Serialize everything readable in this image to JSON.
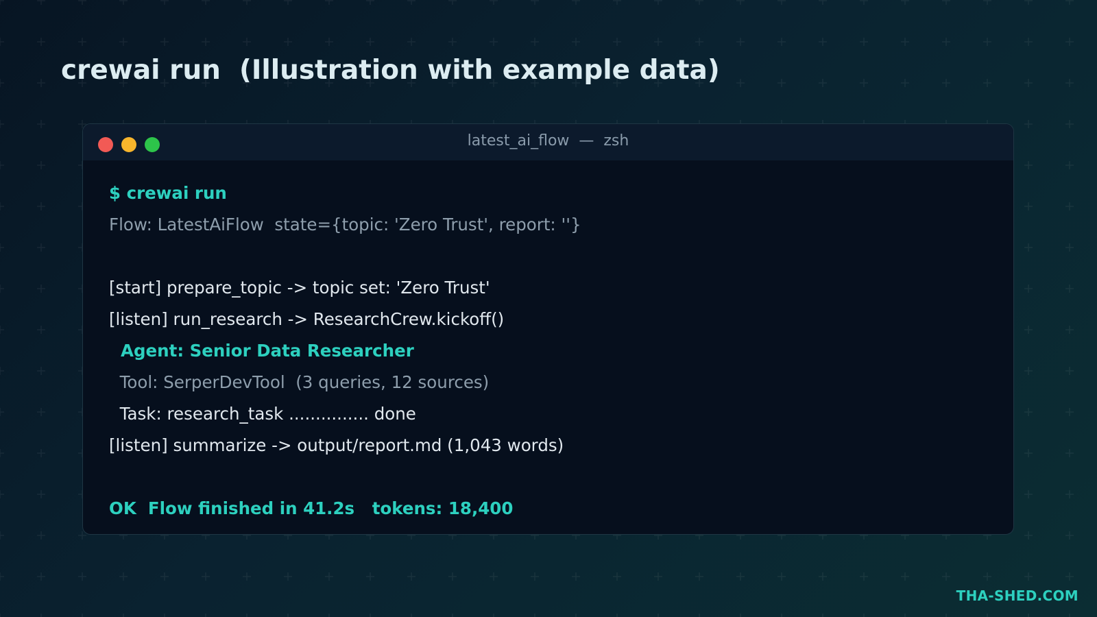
{
  "page": {
    "title": "crewai run  (Illustration with example data)",
    "watermark": "THA-SHED.COM"
  },
  "terminal": {
    "window_title": "latest_ai_flow  —  zsh",
    "controls": [
      "close",
      "minimize",
      "zoom"
    ],
    "lines": {
      "command": "$ crewai run",
      "flow_info": "Flow: LatestAiFlow  state={topic: 'Zero Trust', report: ''}",
      "start_step": "[start] prepare_topic -> topic set: 'Zero Trust'",
      "listen_research": "[listen] run_research -> ResearchCrew.kickoff()",
      "agent": "  Agent: Senior Data Researcher",
      "tool": "  Tool: SerperDevTool  (3 queries, 12 sources)",
      "task": "  Task: research_task ............... done",
      "listen_summarize": "[listen] summarize -> output/report.md (1,043 words)",
      "result": "OK  Flow finished in 41.2s   tokens: 18,400"
    }
  },
  "colors": {
    "accent": "#2dd0bf",
    "title_text": "#dcecf1",
    "terminal_bg": "#060f1d",
    "titlebar_bg": "#0c1a2c",
    "dim_text": "#8e9eac",
    "close_button": "#f25a55",
    "minimize_button": "#f7b52c",
    "zoom_button": "#2dc44a"
  }
}
